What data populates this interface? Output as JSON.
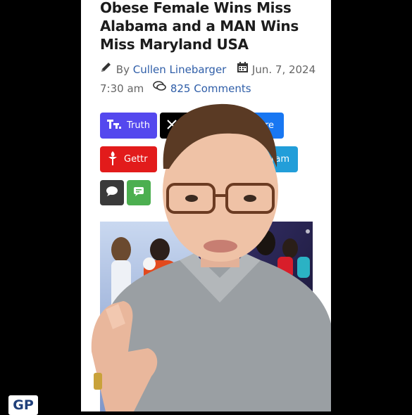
{
  "article": {
    "headline": "Obese Female Wins Miss Alabama and a MAN Wins Miss Maryland USA",
    "by_label": "By",
    "author": "Cullen Linebarger",
    "date": "Jun. 7, 2024 7:30 am",
    "comments": "825 Comments"
  },
  "share_buttons": {
    "truth": "Truth",
    "x_fragment": "",
    "share_fragment": "re",
    "gettr": "Gettr",
    "telegram_fragment": "ram"
  },
  "watermark": {
    "logo_text": "GP"
  },
  "colors": {
    "truth": "#5448ee",
    "x": "#000000",
    "share": "#1877f2",
    "gettr": "#e21b1b",
    "telegram": "#229ed9",
    "comment": "#3a3a3a",
    "sms": "#4caf50",
    "link": "#2f5ea8"
  }
}
